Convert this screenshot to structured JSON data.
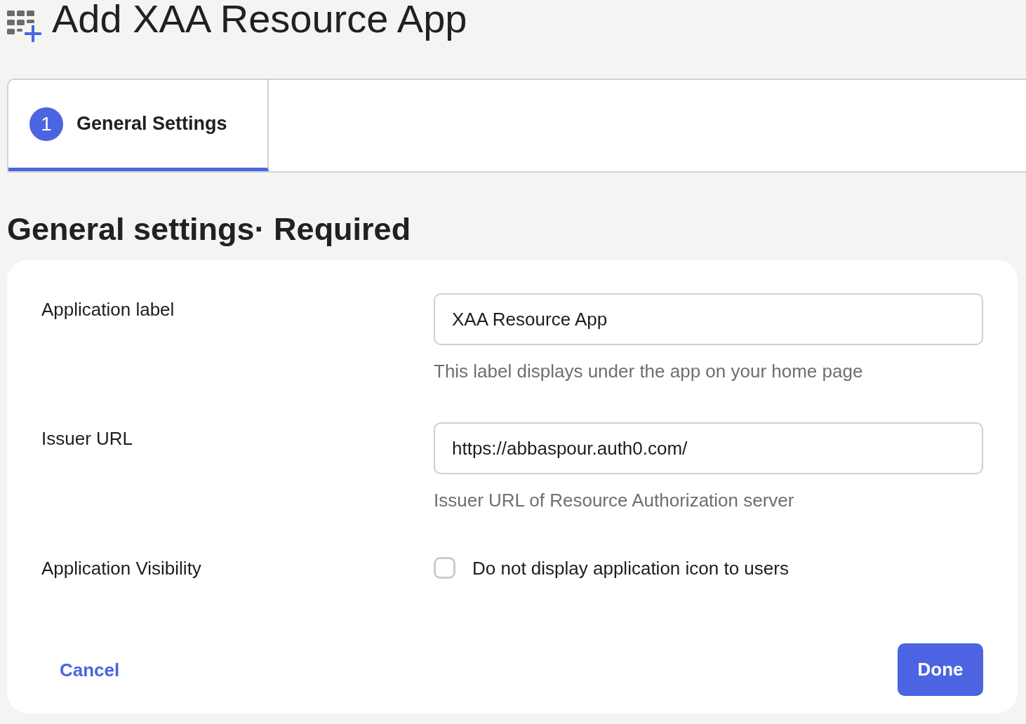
{
  "page": {
    "title": "Add XAA Resource App"
  },
  "steps": [
    {
      "number": "1",
      "label": "General Settings",
      "selected": true
    }
  ],
  "section": {
    "heading": "General settings· Required"
  },
  "form": {
    "fields": [
      {
        "kind": "text",
        "label": "Application label",
        "value": "XAA Resource App",
        "help": "This label displays under the app on your home page"
      },
      {
        "kind": "text",
        "label": "Issuer URL",
        "value": "https://abbaspour.auth0.com/",
        "help": "Issuer URL of Resource Authorization server"
      },
      {
        "kind": "checkbox",
        "label": "Application Visibility",
        "option": "Do not display application icon to users",
        "checked": false
      }
    ]
  },
  "actions": {
    "cancel": "Cancel",
    "done": "Done"
  }
}
